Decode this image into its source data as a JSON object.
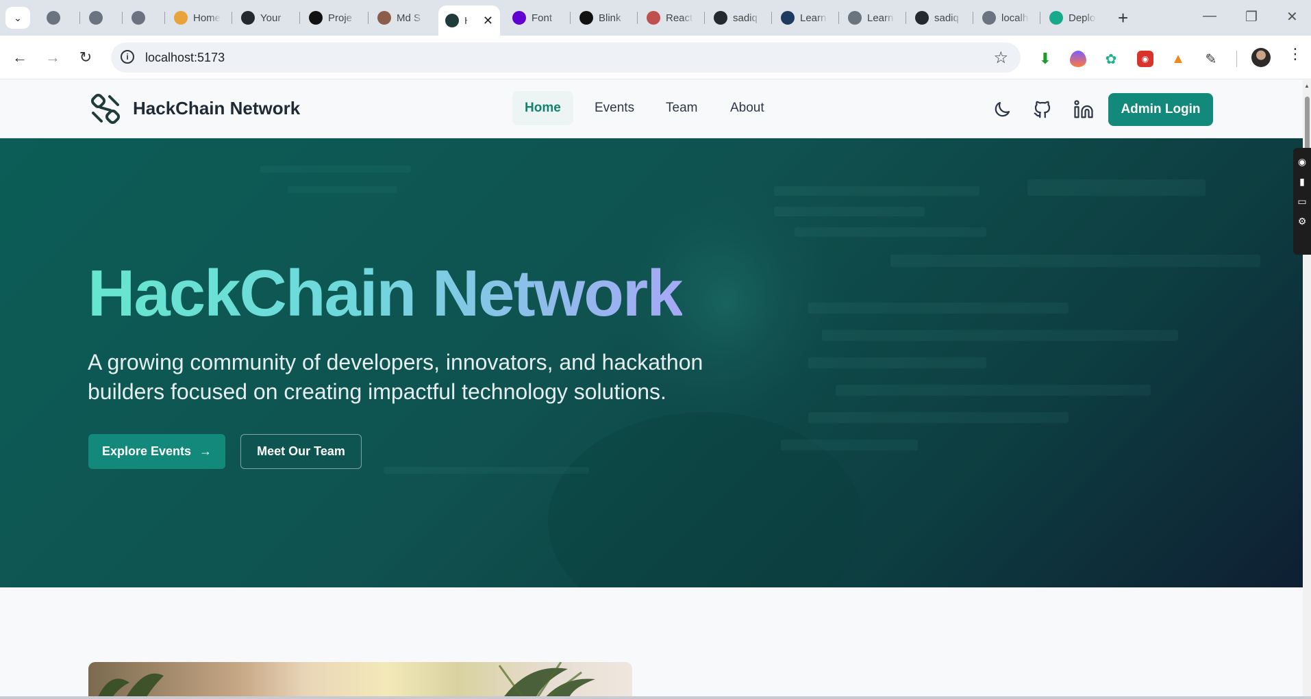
{
  "browser": {
    "tabs": [
      {
        "label": "",
        "favicon": "globe-icon"
      },
      {
        "label": "",
        "favicon": "globe-icon"
      },
      {
        "label": "",
        "favicon": "globe-icon"
      },
      {
        "label": "Home",
        "favicon": "home-site-icon"
      },
      {
        "label": "Your",
        "favicon": "github-icon"
      },
      {
        "label": "Proje",
        "favicon": "openai-icon"
      },
      {
        "label": "Md S",
        "favicon": "avatar-icon"
      },
      {
        "label": "H",
        "favicon": "hackchain-icon",
        "active": true
      },
      {
        "label": "Font",
        "favicon": "yahoo-icon"
      },
      {
        "label": "Blink",
        "favicon": "blinkit-icon"
      },
      {
        "label": "React",
        "favicon": "image-icon"
      },
      {
        "label": "sadiq",
        "favicon": "github-icon"
      },
      {
        "label": "Learn",
        "favicon": "devto-icon"
      },
      {
        "label": "Learn",
        "favicon": "globe-icon"
      },
      {
        "label": "sadiq",
        "favicon": "github-icon"
      },
      {
        "label": "localh",
        "favicon": "globe-icon"
      },
      {
        "label": "Deplo",
        "favicon": "deploy-icon"
      }
    ],
    "url": "localhost:5173"
  },
  "header": {
    "brand": "HackChain Network",
    "nav": [
      "Home",
      "Events",
      "Team",
      "About"
    ],
    "active_nav": "Home",
    "admin_label": "Admin Login"
  },
  "hero": {
    "title": "HackChain Network",
    "subtitle_line1": "A growing community of developers, innovators, and hackathon",
    "subtitle_line2": "builders focused on creating impactful technology solutions.",
    "primary_label": "Explore Events",
    "secondary_label": "Meet Our Team"
  },
  "colors": {
    "accent": "#12897a",
    "hero_dark": "#0e1f33"
  }
}
